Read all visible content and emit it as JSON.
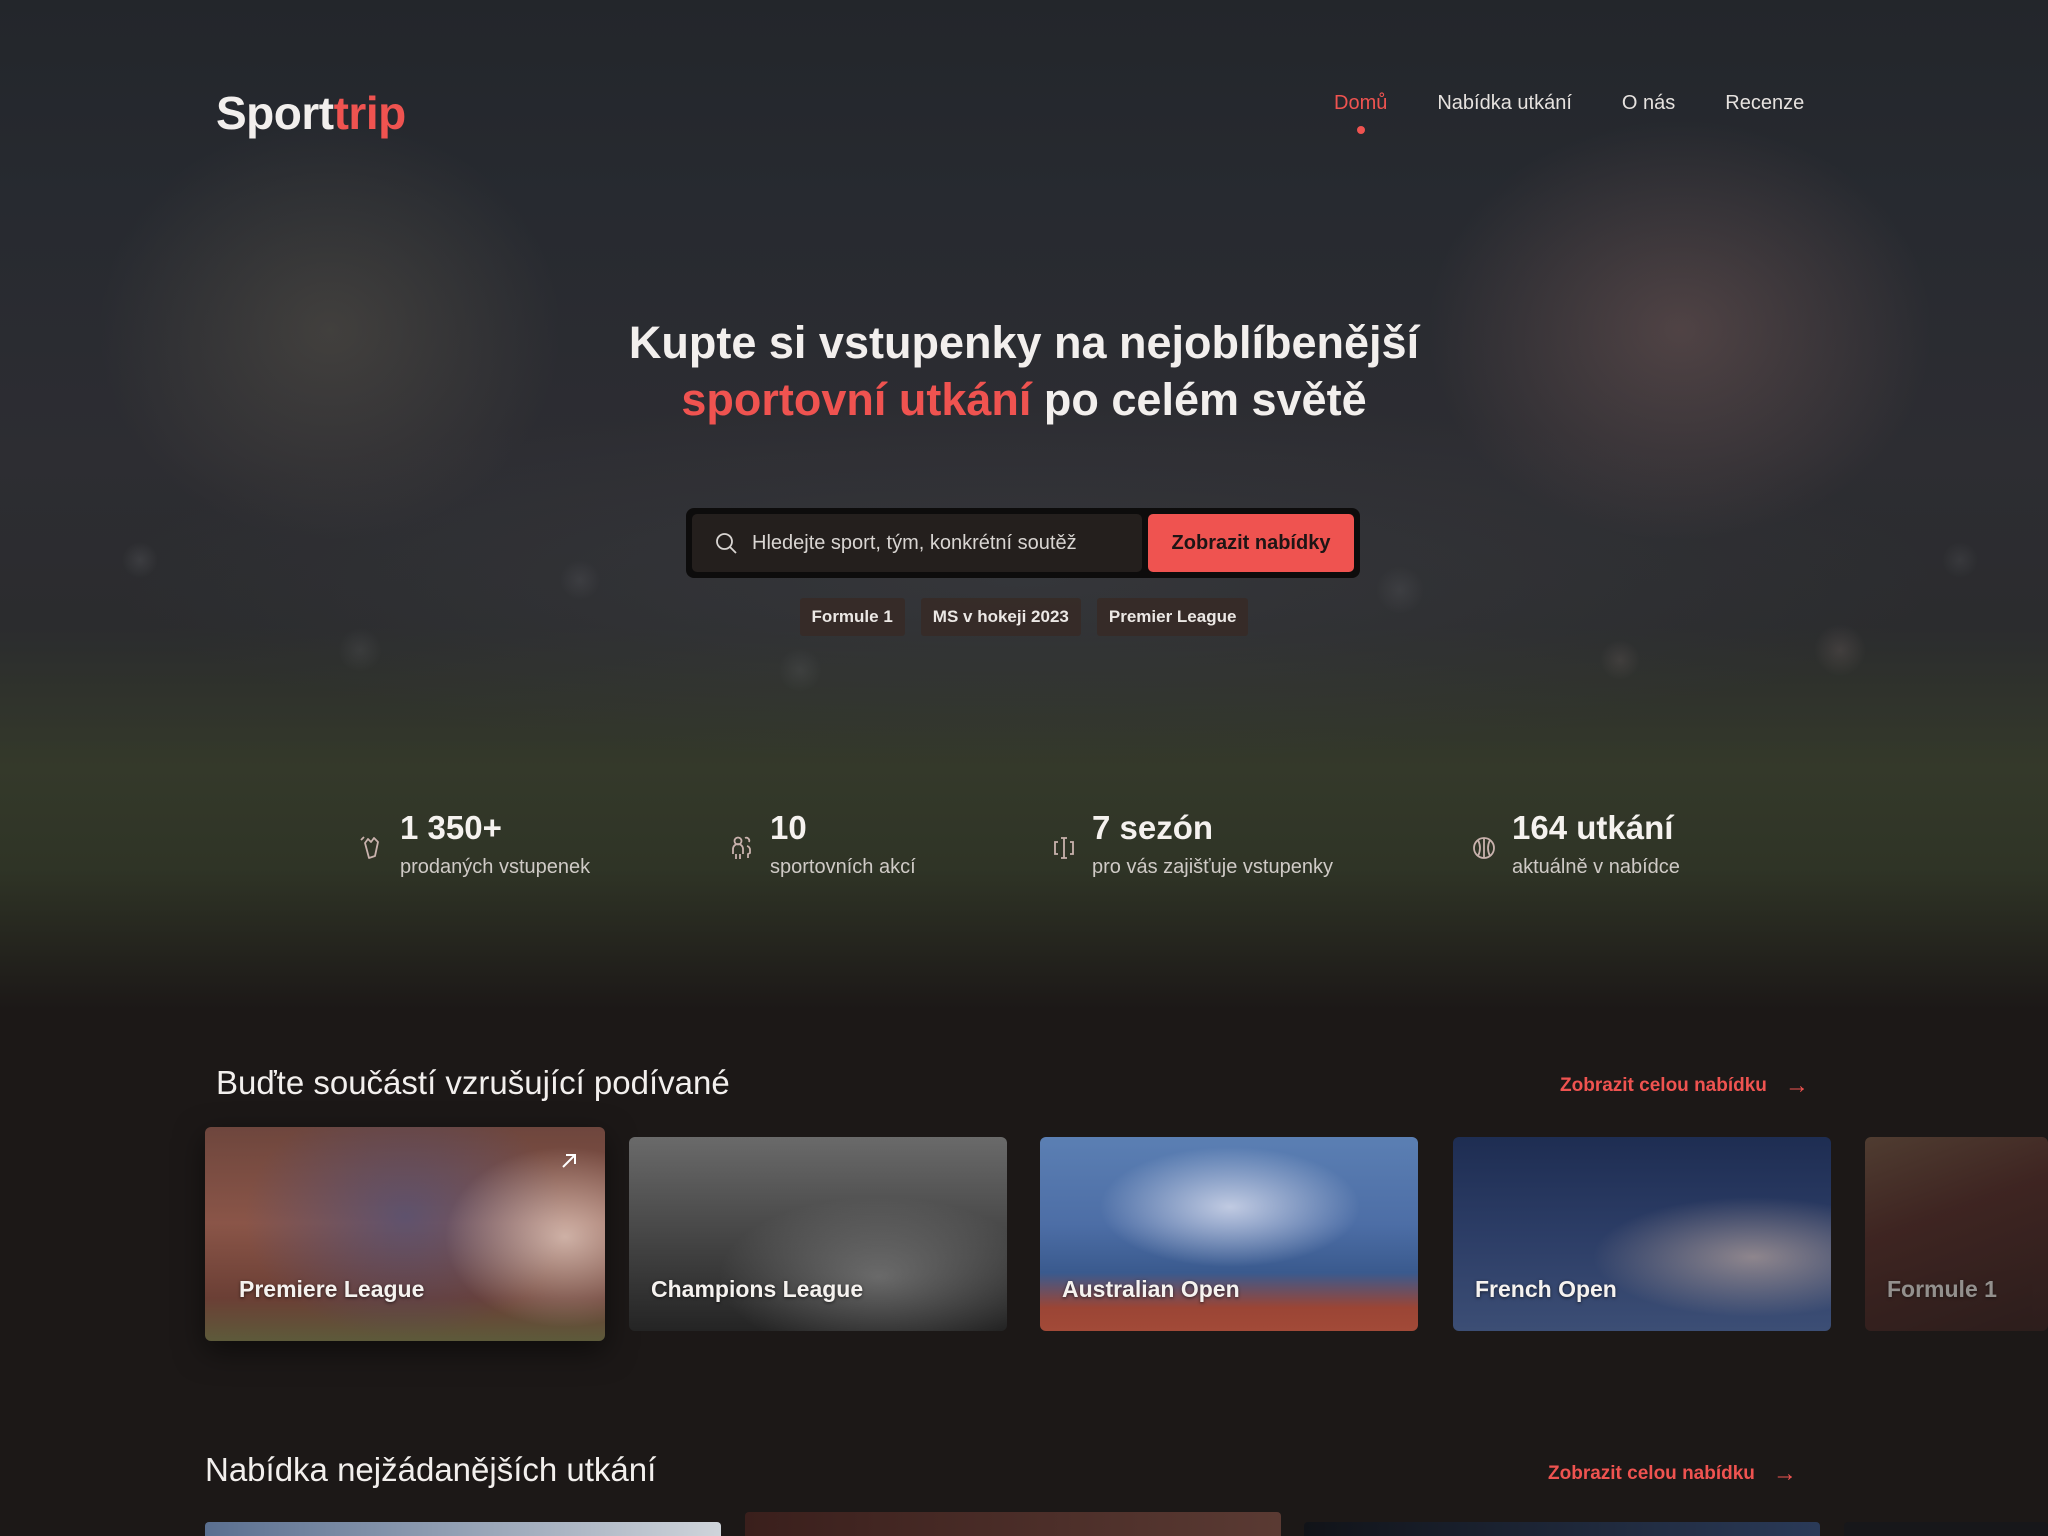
{
  "brand": {
    "part1": "Sport",
    "part2": "trip"
  },
  "nav": {
    "items": [
      {
        "label": "Domů",
        "active": true
      },
      {
        "label": "Nabídka utkání",
        "active": false
      },
      {
        "label": "O nás",
        "active": false
      },
      {
        "label": "Recenze",
        "active": false
      }
    ]
  },
  "hero": {
    "line1": "Kupte si vstupenky na nejoblíbenější",
    "line2_accent": "sportovní utkání",
    "line2_rest": " po celém světě"
  },
  "search": {
    "placeholder": "Hledejte sport, tým, konkrétní soutěž",
    "value": "",
    "button_label": "Zobrazit nabídky",
    "icon": "search-icon"
  },
  "quick_tags": [
    "Formule 1",
    "MS v hokeji 2023",
    "Premier League"
  ],
  "stats": [
    {
      "icon": "ticket-icon",
      "value": "1 350+",
      "label": "prodaných vstupenek"
    },
    {
      "icon": "people-icon",
      "value": "10",
      "label": "sportovních akcí"
    },
    {
      "icon": "season-icon",
      "value": "7 sezón",
      "label": "pro vás zajišťuje vstupenky"
    },
    {
      "icon": "ball-icon",
      "value": "164 utkání",
      "label": "aktuálně v nabídce"
    }
  ],
  "section1": {
    "title": "Buďte součástí vzrušující podívané",
    "link": "Zobrazit celou nabídku",
    "cards": [
      "Premiere League",
      "Champions League",
      "Australian Open",
      "French Open",
      "Formule 1"
    ]
  },
  "section2": {
    "title": "Nabídka nejžádanějších utkání",
    "link": "Zobrazit celou nabídku"
  },
  "colors": {
    "accent": "#ef5350",
    "background": "#1c1817",
    "text": "#f2efed"
  }
}
